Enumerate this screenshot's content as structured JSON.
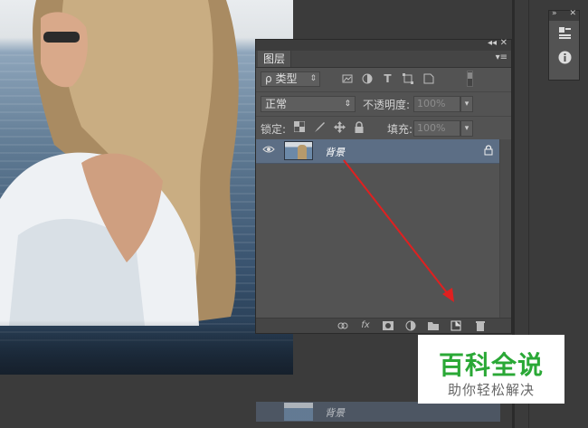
{
  "panel": {
    "tab_label": "图层",
    "collapse_glyph": "◂◂",
    "close_glyph": "✕",
    "menu_glyph": "▾≡",
    "filter": {
      "search_glyph": "ρ",
      "label": "类型",
      "arrow": "⇕",
      "icons": [
        "image-filter-icon",
        "adjustment-filter-icon",
        "text-filter-icon",
        "shape-filter-icon",
        "smartobject-filter-icon"
      ],
      "text_icon_glyph": "T"
    },
    "blend_mode": "正常",
    "blend_arrow": "⇕",
    "opacity_label": "不透明度:",
    "opacity_value": "100%",
    "lock_label": "锁定:",
    "fill_label": "填充:",
    "fill_value": "100%",
    "dropdown_arrow": "▾",
    "layers": [
      {
        "name": "背景",
        "visible": true,
        "locked": true,
        "selected": true
      }
    ],
    "ghost_layer_name": "背景",
    "bottom_icons": [
      "link-icon",
      "fx-icon",
      "mask-icon",
      "adjustment-icon",
      "folder-icon",
      "new-layer-icon",
      "trash-icon"
    ],
    "fx_label": "fx"
  },
  "mini_panel": {
    "close_glyph": "✕",
    "collapse_glyph": "»",
    "icons": [
      "properties-icon",
      "info-icon"
    ]
  },
  "watermark": {
    "title": "百科全说",
    "subtitle": "助你轻松解决"
  },
  "colors": {
    "panel_bg": "#535353",
    "selected_layer": "#5c6e85",
    "arrow": "#e02020",
    "watermark_green": "#2aa836"
  }
}
